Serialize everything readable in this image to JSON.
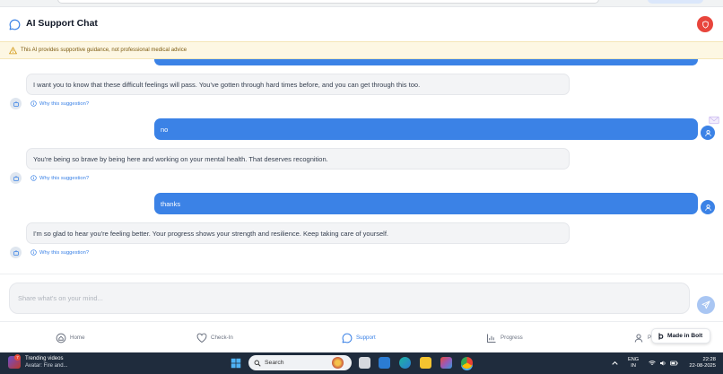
{
  "header": {
    "title": "AI Support Chat"
  },
  "disclaimer": {
    "text": "This AI provides supportive guidance, not professional medical advice"
  },
  "messages": [
    {
      "role": "bot",
      "text": "I want you to know that these difficult feelings will pass. You've gotten through hard times before, and you can get through this too.",
      "why": "Why this suggestion?"
    },
    {
      "role": "user",
      "text": "no"
    },
    {
      "role": "bot",
      "text": "You're being so brave by being here and working on your mental health. That deserves recognition.",
      "why": "Why this suggestion?"
    },
    {
      "role": "user",
      "text": "thanks"
    },
    {
      "role": "bot",
      "text": "I'm so glad to hear you're feeling better. Your progress shows your strength and resilience. Keep taking care of yourself.",
      "why": "Why this suggestion?"
    }
  ],
  "input": {
    "placeholder": "Share what's on your mind..."
  },
  "nav": {
    "home": "Home",
    "checkin": "Check-In",
    "support": "Support",
    "progress": "Progress",
    "profile": "P",
    "active": "support"
  },
  "bolt_badge": "Made in Bolt",
  "taskbar": {
    "news_count": "7",
    "news_title": "Trending videos",
    "news_sub": "Avatar: Fire and...",
    "search": "Search",
    "lang_1": "ENG",
    "lang_2": "IN",
    "time": "22:28",
    "date": "22-08-2025"
  },
  "colors": {
    "accent": "#3b82e6",
    "alert": "#e8453c",
    "disclaimer_bg": "#fdf7e3"
  }
}
